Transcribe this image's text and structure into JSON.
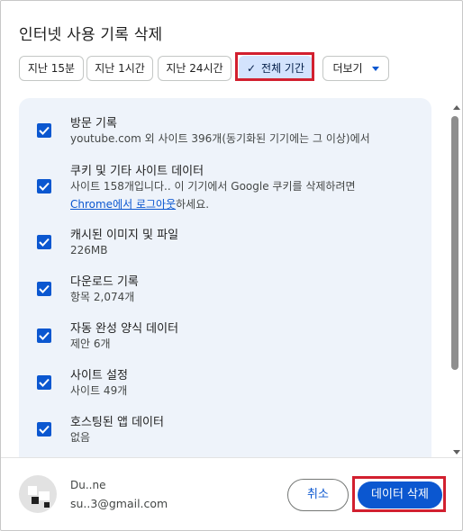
{
  "dialog": {
    "title": "인터넷 사용 기록 삭제"
  },
  "time_range": {
    "chips": [
      "지난 15분",
      "지난 1시간",
      "지난 24시간",
      "전체 기간"
    ],
    "selected_index": 3,
    "more_label": "더보기"
  },
  "items": [
    {
      "title": "방문 기록",
      "sub": "youtube.com 외 사이트 396개(동기화된 기기에는 그 이상)에서",
      "checked": true
    },
    {
      "title": "쿠키 및 기타 사이트 데이터",
      "sub": "사이트 158개입니다.. 이 기기에서 Google 쿠키를 삭제하려면",
      "sub2_link": "Chrome에서 로그아웃",
      "sub2_rest": "하세요.",
      "checked": true
    },
    {
      "title": "캐시된 이미지 및 파일",
      "sub": "226MB",
      "checked": true
    },
    {
      "title": "다운로드 기록",
      "sub": "항목 2,074개",
      "checked": true
    },
    {
      "title": "자동 완성 양식 데이터",
      "sub": "제안 6개",
      "checked": true
    },
    {
      "title": "사이트 설정",
      "sub": "사이트 49개",
      "checked": true
    },
    {
      "title": "호스팅된 앱 데이터",
      "sub": "없음",
      "checked": true
    }
  ],
  "account": {
    "name": "Du..ne",
    "email": "su..3@gmail.com"
  },
  "buttons": {
    "cancel": "취소",
    "delete": "데이터 삭제"
  },
  "colors": {
    "accent": "#0b57d0",
    "selected_chip": "#d3e3fd",
    "highlight_box": "#d2202f",
    "panel": "#eef3fa"
  }
}
